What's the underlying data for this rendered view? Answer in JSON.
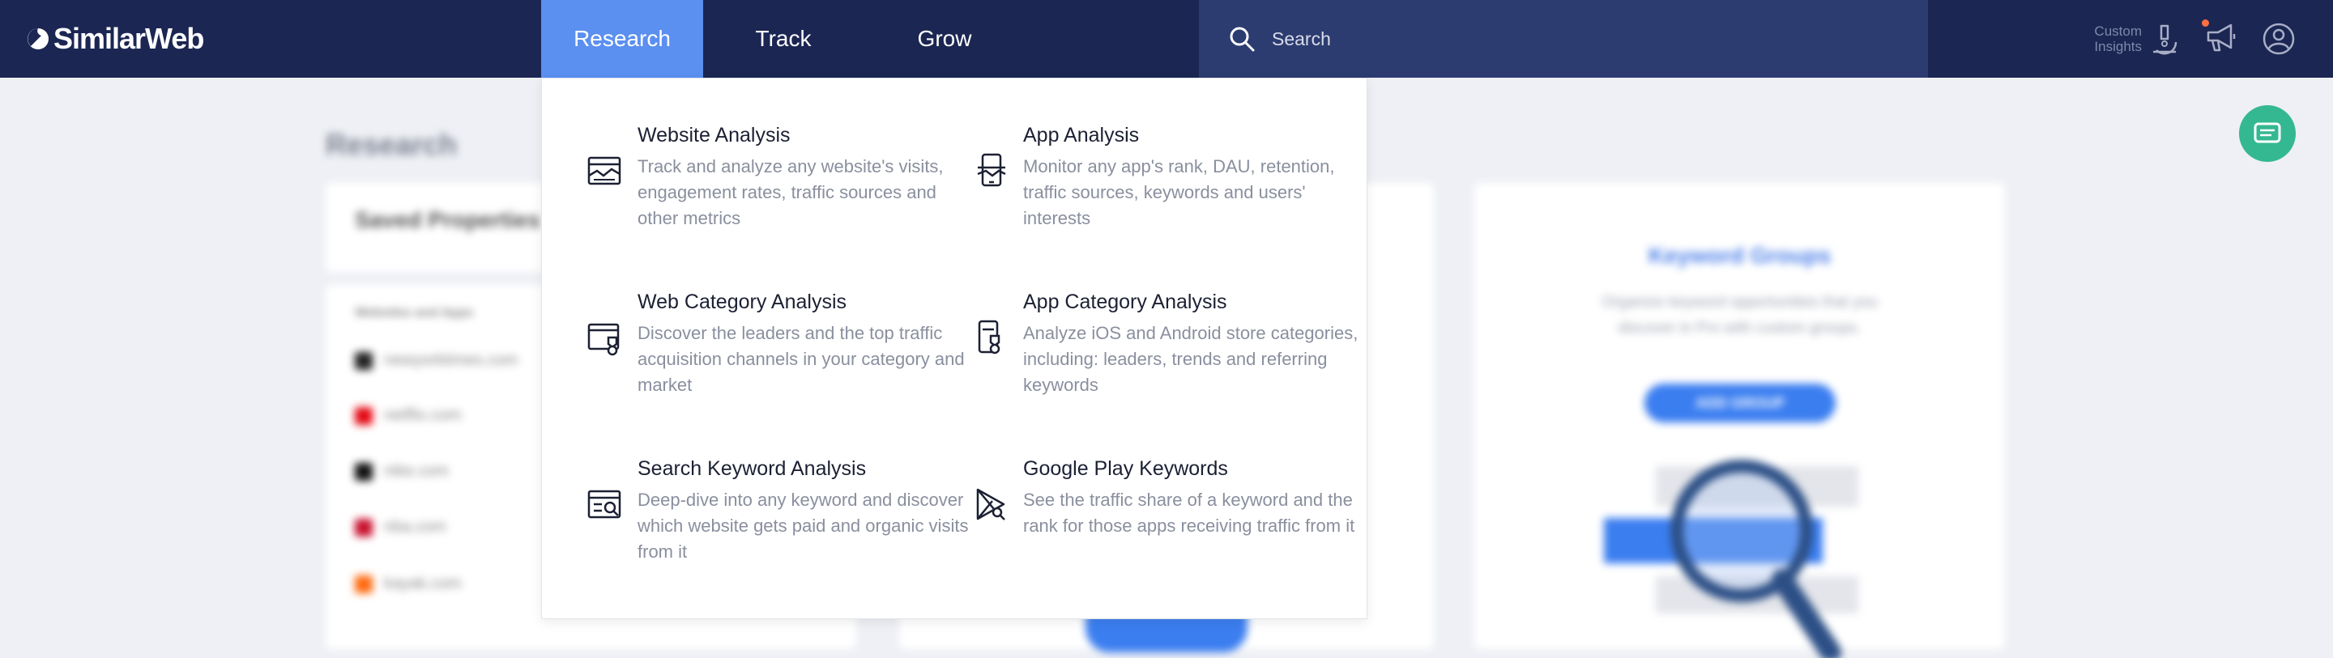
{
  "header": {
    "logo": "SimilarWeb",
    "tabs": [
      {
        "label": "Research",
        "active": true
      },
      {
        "label": "Track",
        "active": false
      },
      {
        "label": "Grow",
        "active": false
      }
    ],
    "search": {
      "placeholder": "Search",
      "value": ""
    },
    "custom_insights": {
      "line1": "Custom",
      "line2": "Insights"
    },
    "icons": [
      "search-icon",
      "microscope-icon",
      "megaphone-icon",
      "user-icon"
    ]
  },
  "dropdown": {
    "items": [
      {
        "title": "Website Analysis",
        "desc": "Track and analyze any website's visits, engagement rates, traffic sources and other metrics",
        "icon": "website-analysis-icon"
      },
      {
        "title": "App Analysis",
        "desc": "Monitor any app's rank, DAU, retention, traffic sources, keywords and users' interests",
        "icon": "app-analysis-icon"
      },
      {
        "title": "Web Category Analysis",
        "desc": "Discover the leaders and the top traffic acquisition channels in your category and market",
        "icon": "web-category-icon"
      },
      {
        "title": "App Category Analysis",
        "desc": "Analyze iOS and Android store categories, including: leaders, trends and referring keywords",
        "icon": "app-category-icon"
      },
      {
        "title": "Search Keyword Analysis",
        "desc": "Deep-dive into any keyword and discover which website gets paid and organic visits from it",
        "icon": "search-keyword-icon"
      },
      {
        "title": "Google Play Keywords",
        "desc": "See the traffic share of a keyword and the rank for those apps receiving traffic from it",
        "icon": "google-play-icon"
      }
    ]
  },
  "background": {
    "title": "Research",
    "saved_properties": {
      "title": "Saved Properties",
      "subheader": "Websites and Apps",
      "sites": [
        {
          "name": "newyorktimes.com",
          "color": "#222222"
        },
        {
          "name": "netflix.com",
          "color": "#e50914"
        },
        {
          "name": "nike.com",
          "color": "#111111"
        },
        {
          "name": "nba.com",
          "color": "#c8102e"
        },
        {
          "name": "kayak.com",
          "color": "#ff690f"
        }
      ]
    },
    "keyword_groups": {
      "title": "Keyword Groups",
      "desc": "Organize keyword opportunities that you discover in Pro with custom groups.",
      "button": "ADD GROUP"
    }
  },
  "colors": {
    "nav_bg": "#1b2653",
    "active_tab": "#5b8ff0",
    "search_bg": "#2c3c70",
    "accent": "#3b7ef0",
    "notification": "#ff6e40"
  }
}
